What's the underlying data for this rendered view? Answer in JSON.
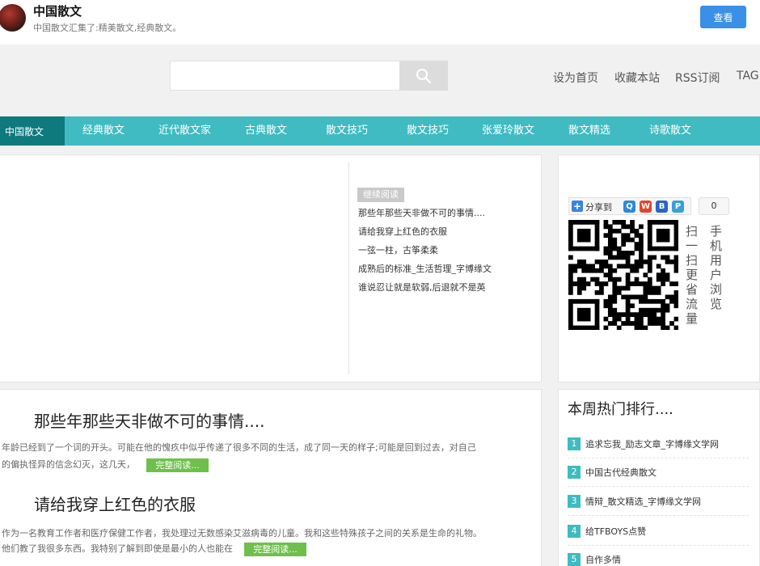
{
  "header": {
    "site_title": "中国散文",
    "site_subtitle": "中国散文汇集了:精美散文,经典散文。",
    "view_button": "查看"
  },
  "search": {
    "placeholder": ""
  },
  "header_links": [
    "设为首页",
    "收藏本站",
    "RSS订阅",
    "TAG"
  ],
  "nav": {
    "active": "中国散文",
    "items": [
      "经典散文",
      "近代散文家",
      "古典散文",
      "散文技巧",
      "散文技巧",
      "张爱玲散文",
      "散文精选",
      "诗歌散文"
    ]
  },
  "slider": {
    "badge": "继续阅读",
    "links": [
      "那些年那些天非做不可的事情....",
      "请给我穿上红色的衣服",
      "一弦一柱，古筝柔柔",
      "成熟后的标准_生活哲理_字博缘文",
      "谁说忍让就是软弱,后退就不是英"
    ]
  },
  "share": {
    "label": "分享到",
    "count": "0"
  },
  "qr": {
    "caption_col1": "扫一扫更省流量",
    "caption_col2": "手机用户浏览"
  },
  "articles": [
    {
      "title": "那些年那些天非做不可的事情....",
      "line1": "年龄已经到了一个词的开头。可能在他的愧疚中似乎传递了很多不同的生活，成了同一天的样子;可能是回到过去，对自己",
      "line2": "的偏执怪异的信念幻灭，这几天，",
      "readmore": "完整阅读..."
    },
    {
      "title": "请给我穿上红色的衣服",
      "line1": "作为一名教育工作者和医疗保健工作者，我处理过无数感染艾滋病毒的儿童。我和这些特殊孩子之间的关系是生命的礼物。",
      "line2": "他们教了我很多东西。我特别了解到即使是最小的人也能在",
      "readmore": "完整阅读..."
    }
  ],
  "ranking": {
    "title": "本周热门排行....",
    "items": [
      {
        "num": "1",
        "text": "追求忘我_励志文章_字博缘文学网"
      },
      {
        "num": "2",
        "text": "中国古代经典散文"
      },
      {
        "num": "3",
        "text": "情辩_散文精选_字博缘文学网"
      },
      {
        "num": "4",
        "text": "给TFBOYS点赞"
      },
      {
        "num": "5",
        "text": "自作多情"
      }
    ]
  }
}
